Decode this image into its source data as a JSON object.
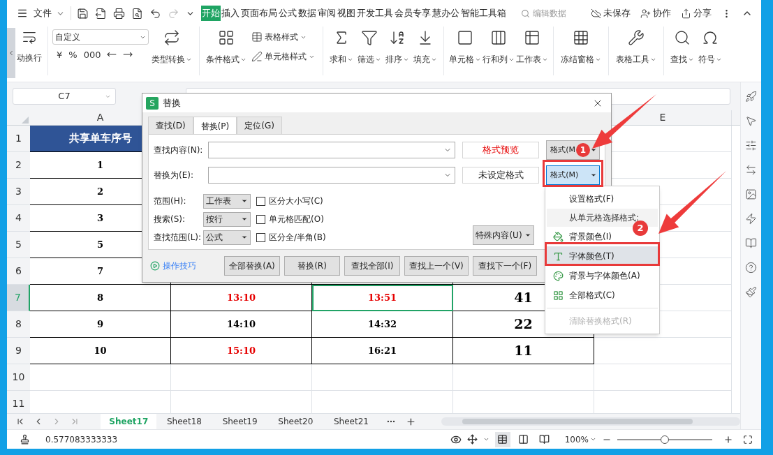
{
  "top_bar": {
    "file_menu": "文件",
    "tabs": [
      {
        "label": "开始",
        "selected": true
      },
      {
        "label": "插入",
        "selected": false
      },
      {
        "label": "页面布局",
        "selected": false
      },
      {
        "label": "公式",
        "selected": false
      },
      {
        "label": "数据",
        "selected": false
      },
      {
        "label": "审阅",
        "selected": false
      },
      {
        "label": "视图",
        "selected": false
      },
      {
        "label": "开发工具",
        "selected": false
      },
      {
        "label": "会员专享",
        "selected": false
      },
      {
        "label": "慧办公",
        "selected": false
      },
      {
        "label": "智能工具箱",
        "selected": false
      }
    ],
    "search": {
      "placeholder": "编辑数据"
    },
    "actions": [
      "未保存",
      "协作",
      "分享"
    ]
  },
  "ribbon": {
    "wrap_text": "动换行",
    "number_format": "自定义",
    "number_buttons": [
      "¥",
      "%",
      "000"
    ],
    "type_convert": "类型转换",
    "conditional_format": "条件格式",
    "style_buttons": [
      "表格样式",
      "单元格样式"
    ],
    "groups": [
      [
        "求和",
        "筛选",
        "排序",
        "填充"
      ],
      [
        "单元格",
        "行和列",
        "工作表"
      ],
      [
        "冻结窗格"
      ],
      [
        "表格工具"
      ],
      [
        "查找",
        "符号"
      ]
    ]
  },
  "formula_bar": {
    "name_box": "C7"
  },
  "sheet": {
    "column_headers": {
      "column_1": "A",
      "column_5": "E"
    },
    "rows": [
      {
        "number": "1",
        "selected": false,
        "cells": [
          {
            "text": "共享单车序号",
            "kind": "header",
            "selected": false
          }
        ]
      },
      {
        "number": "2",
        "selected": false,
        "cells": [
          {
            "text": "1",
            "kind": "data",
            "red": false,
            "selected": false
          }
        ]
      },
      {
        "number": "3",
        "selected": false,
        "cells": [
          {
            "text": "2",
            "kind": "data",
            "red": false,
            "selected": false
          }
        ]
      },
      {
        "number": "4",
        "selected": false,
        "cells": [
          {
            "text": "3",
            "kind": "data",
            "red": false,
            "selected": false
          }
        ]
      },
      {
        "number": "5",
        "selected": false,
        "cells": [
          {
            "text": "5",
            "kind": "data",
            "red": false,
            "selected": false
          }
        ]
      },
      {
        "number": "6",
        "selected": false,
        "cells": [
          {
            "text": "7",
            "kind": "data",
            "red": false,
            "selected": false
          }
        ]
      },
      {
        "number": "7",
        "selected": true,
        "cells": [
          {
            "text": "8",
            "kind": "data",
            "red": false,
            "selected": false
          },
          {
            "text": "13:10",
            "kind": "data",
            "red": true,
            "selected": false
          },
          {
            "text": "13:51",
            "kind": "data",
            "red": true,
            "selected": true
          },
          {
            "text": "41",
            "kind": "big",
            "red": false,
            "selected": false
          }
        ]
      },
      {
        "number": "8",
        "selected": false,
        "cells": [
          {
            "text": "9",
            "kind": "data",
            "red": false,
            "selected": false
          },
          {
            "text": "14:10",
            "kind": "data",
            "red": false,
            "selected": false
          },
          {
            "text": "14:32",
            "kind": "data",
            "red": false,
            "selected": false
          },
          {
            "text": "22",
            "kind": "big",
            "red": false,
            "selected": false
          }
        ]
      },
      {
        "number": "9",
        "selected": false,
        "cells": [
          {
            "text": "10",
            "kind": "data",
            "red": false,
            "selected": false
          },
          {
            "text": "15:10",
            "kind": "data",
            "red": true,
            "selected": false
          },
          {
            "text": "16:21",
            "kind": "data",
            "red": false,
            "selected": false
          },
          {
            "text": "11",
            "kind": "big",
            "red": false,
            "selected": false
          }
        ]
      },
      {
        "number": "10",
        "selected": false
      },
      {
        "number": "11",
        "selected": false
      }
    ]
  },
  "sheet_tabs": [
    {
      "label": "Sheet17",
      "selected": true
    },
    {
      "label": "Sheet18",
      "selected": false
    },
    {
      "label": "Sheet19",
      "selected": false
    },
    {
      "label": "Sheet20",
      "selected": false
    },
    {
      "label": "Sheet21",
      "selected": false
    }
  ],
  "status_bar": {
    "cell_value": "0.577083333333",
    "view_modes": [
      {
        "selected": true
      },
      {
        "selected": false
      },
      {
        "selected": false
      }
    ],
    "zoom": "100%",
    "zoom_slider": {
      "level": 0.5
    }
  },
  "dialog": {
    "logo": "S",
    "title": "替换",
    "tabs": [
      {
        "label": "查找(D)",
        "selected": false
      },
      {
        "label": "替换(P)",
        "selected": true
      },
      {
        "label": "定位(G)",
        "selected": false
      }
    ],
    "fields": [
      {
        "label": "查找内容(N):",
        "preview": "格式预览",
        "preview_red": true,
        "format_button": "格式(M",
        "active": false
      },
      {
        "label": "替换为(E):",
        "preview": "未设定格式",
        "preview_red": false,
        "format_button": "格式(M)",
        "active": true
      }
    ],
    "options": [
      {
        "label": "范围(H):",
        "value": "工作表",
        "checkbox": "区分大小写(C)",
        "checked": false
      },
      {
        "label": "搜索(S):",
        "value": "按行",
        "checkbox": "单元格匹配(O)",
        "checked": false
      },
      {
        "label": "查找范围(L):",
        "value": "公式",
        "checkbox": "区分全/半角(B)",
        "checked": false
      }
    ],
    "special_button": "特殊内容(U)",
    "tips_link": "操作技巧",
    "buttons": [
      "全部替换(A)",
      "替换(R)",
      "查找全部(I)",
      "查找上一个(V)",
      "查找下一个(F)"
    ]
  },
  "format_menu": [
    {
      "label": "设置格式(F)",
      "kind": "action",
      "selected": false,
      "disabled": false
    },
    {
      "label": "从单元格选择格式:",
      "kind": "header"
    },
    {
      "label": "背景颜色(I)",
      "kind": "pick",
      "selected": false,
      "disabled": false
    },
    {
      "label": "字体颜色(T)",
      "kind": "pick",
      "selected": true,
      "disabled": false
    },
    {
      "label": "背景与字体颜色(A)",
      "kind": "pick",
      "selected": false,
      "disabled": false
    },
    {
      "label": "全部格式(C)",
      "kind": "pick",
      "selected": false,
      "disabled": false
    },
    {
      "kind": "separator"
    },
    {
      "label": "清除替换格式(R)",
      "kind": "action",
      "selected": false,
      "disabled": true
    }
  ],
  "annotations": {
    "badges": [
      "1",
      "2"
    ]
  }
}
